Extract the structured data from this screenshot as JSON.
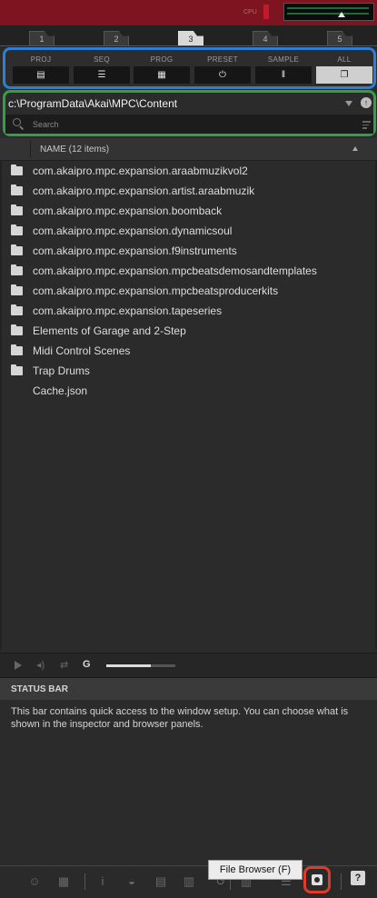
{
  "topbar": {
    "cpu_label": "CPU"
  },
  "pad_tabs": [
    {
      "label": "1",
      "active": false
    },
    {
      "label": "2",
      "active": false
    },
    {
      "label": "3",
      "active": true
    },
    {
      "label": "4",
      "active": false
    },
    {
      "label": "5",
      "active": false
    }
  ],
  "filters": [
    {
      "label": "PROJ",
      "icon": "document-icon",
      "glyph": "▤",
      "active": false
    },
    {
      "label": "SEQ",
      "icon": "sequence-icon",
      "glyph": "☰",
      "active": false
    },
    {
      "label": "PROG",
      "icon": "grid-icon",
      "glyph": "▦",
      "active": false
    },
    {
      "label": "PRESET",
      "icon": "plug-icon",
      "glyph": "⏻",
      "active": false
    },
    {
      "label": "SAMPLE",
      "icon": "waveform-icon",
      "glyph": "‖",
      "active": false
    },
    {
      "label": "ALL",
      "icon": "copy-icon",
      "glyph": "❐",
      "active": true
    }
  ],
  "browser": {
    "path": "c:\\ProgramData\\Akai\\MPC\\Content",
    "search_placeholder": "Search",
    "header": "NAME (12 items)"
  },
  "files": [
    {
      "name": "com.akaipro.mpc.expansion.araabmuzikvol2",
      "type": "folder"
    },
    {
      "name": "com.akaipro.mpc.expansion.artist.araabmuzik",
      "type": "folder"
    },
    {
      "name": "com.akaipro.mpc.expansion.boomback",
      "type": "folder"
    },
    {
      "name": "com.akaipro.mpc.expansion.dynamicsoul",
      "type": "folder"
    },
    {
      "name": "com.akaipro.mpc.expansion.f9instruments",
      "type": "folder"
    },
    {
      "name": "com.akaipro.mpc.expansion.mpcbeatsdemosandtemplates",
      "type": "folder"
    },
    {
      "name": "com.akaipro.mpc.expansion.mpcbeatsproducerkits",
      "type": "folder"
    },
    {
      "name": "com.akaipro.mpc.expansion.tapeseries",
      "type": "folder"
    },
    {
      "name": "Elements of Garage and 2-Step",
      "type": "folder"
    },
    {
      "name": "Midi Control Scenes",
      "type": "folder"
    },
    {
      "name": "Trap Drums",
      "type": "folder"
    },
    {
      "name": "Cache.json",
      "type": "file"
    }
  ],
  "transport": {
    "volume_level": 0.65
  },
  "status": {
    "title": "STATUS BAR",
    "body": "This bar contains quick access to the window setup. You can choose what is shown in the inspector and browser panels."
  },
  "bottombar": {
    "tooltip": "File Browser (F)",
    "help_glyph": "?"
  }
}
